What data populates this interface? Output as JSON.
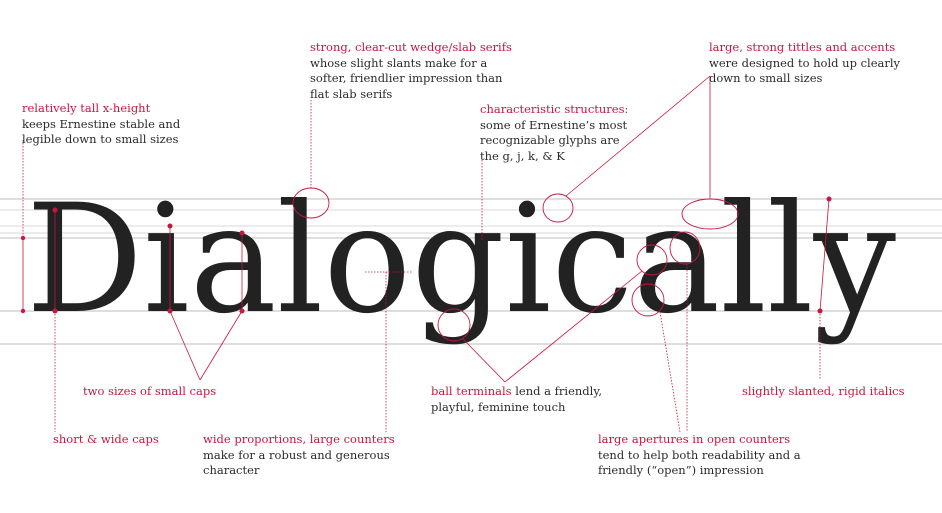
{
  "specimen": {
    "word": "Dialogically"
  },
  "colors": {
    "accent": "#c8163f",
    "ink": "#222222",
    "guide": "#bcbcbc"
  },
  "annotations": {
    "xheight": {
      "highlight": "relatively tall x-height",
      "lines": [
        "keeps Ernestine stable and",
        "legible down to small sizes"
      ]
    },
    "serifs": {
      "highlight": "strong, clear-cut wedge/slab serifs",
      "lines": [
        "whose slight slants make for a",
        "softer, friendlier impression than",
        "flat slab serifs"
      ]
    },
    "structures": {
      "highlight": "characteristic structures:",
      "lines": [
        "some of Ernestine’s most",
        "recognizable glyphs are",
        "the g, j, k, & K"
      ]
    },
    "tittles": {
      "highlight": "large, strong tittles and accents",
      "lines": [
        "were designed to hold up clearly",
        "down to small sizes"
      ]
    },
    "small_caps": {
      "highlight": "two sizes of small caps"
    },
    "caps": {
      "highlight": "short & wide caps"
    },
    "proportions": {
      "highlight": "wide proportions, large counters",
      "lines": [
        "make for a robust and generous",
        "character"
      ]
    },
    "ball": {
      "highlight": "ball terminals",
      "rest": " lend a friendly,",
      "lines": [
        "playful, feminine touch"
      ]
    },
    "italics": {
      "highlight": "slightly slanted, rigid italics"
    },
    "apertures": {
      "highlight": "large apertures in open counters",
      "lines": [
        "tend to help both readability and a",
        "friendly (“open”) impression"
      ]
    }
  }
}
